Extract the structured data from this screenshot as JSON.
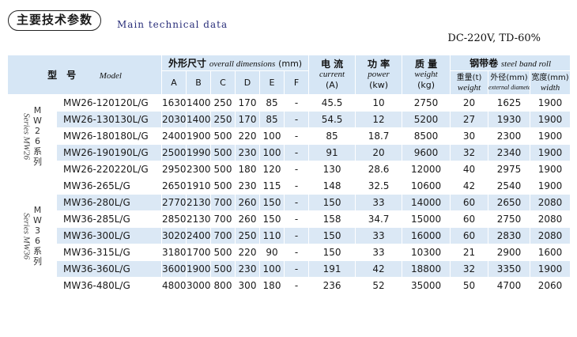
{
  "header": {
    "title": "主要技术参数",
    "subtitle": "Main technical data",
    "conditions": "DC-220V, TD-60%"
  },
  "table": {
    "model_header": {
      "cn": "型　号",
      "en": "Model"
    },
    "dimensions_header": {
      "cn": "外形尺寸",
      "en": "overall dimensions",
      "unit": "(mm)"
    },
    "dimension_cols": [
      "A",
      "B",
      "C",
      "D",
      "E",
      "F"
    ],
    "current_header": {
      "cn": "电 流",
      "en": "current",
      "unit": "(A)"
    },
    "power_header": {
      "cn": "功 率",
      "en": "power",
      "unit": "(kw)"
    },
    "weight_header": {
      "cn": "质 量",
      "en": "weight",
      "unit": "(kg)"
    },
    "band_header": {
      "cn": "钢带卷",
      "en": "steel band roll"
    },
    "band_cols": [
      {
        "cn": "重量(t)",
        "en": "weight"
      },
      {
        "cn": "外径(mm)",
        "en": "external diameter"
      },
      {
        "cn": "宽度(mm)",
        "en": "width"
      }
    ],
    "groups": [
      {
        "series_en": "Series MW26",
        "series_cn": "MW26系列",
        "rows": [
          {
            "model": "MW26-120120L/G",
            "A": "1630",
            "B": "1400",
            "C": "250",
            "D": "170",
            "E": "85",
            "F": "-",
            "current": "45.5",
            "power": "10",
            "weight": "2750",
            "band_weight": "20",
            "band_od": "1625",
            "band_width": "1900"
          },
          {
            "model": "MW26-130130L/G",
            "A": "2030",
            "B": "1400",
            "C": "250",
            "D": "170",
            "E": "85",
            "F": "-",
            "current": "54.5",
            "power": "12",
            "weight": "5200",
            "band_weight": "27",
            "band_od": "1930",
            "band_width": "1900"
          },
          {
            "model": "MW26-180180L/G",
            "A": "2400",
            "B": "1900",
            "C": "500",
            "D": "220",
            "E": "100",
            "F": "-",
            "current": "85",
            "power": "18.7",
            "weight": "8500",
            "band_weight": "30",
            "band_od": "2300",
            "band_width": "1900"
          },
          {
            "model": "MW26-190190L/G",
            "A": "2500",
            "B": "1990",
            "C": "500",
            "D": "230",
            "E": "100",
            "F": "-",
            "current": "91",
            "power": "20",
            "weight": "9600",
            "band_weight": "32",
            "band_od": "2340",
            "band_width": "1900"
          },
          {
            "model": "MW26-220220L/G",
            "A": "2950",
            "B": "2300",
            "C": "500",
            "D": "180",
            "E": "120",
            "F": "-",
            "current": "130",
            "power": "28.6",
            "weight": "12000",
            "band_weight": "40",
            "band_od": "2975",
            "band_width": "1900"
          }
        ]
      },
      {
        "series_en": "Series MW36",
        "series_cn": "MW36系列",
        "rows": [
          {
            "model": "MW36-265L/G",
            "A": "2650",
            "B": "1910",
            "C": "500",
            "D": "230",
            "E": "115",
            "F": "-",
            "current": "148",
            "power": "32.5",
            "weight": "10600",
            "band_weight": "42",
            "band_od": "2540",
            "band_width": "1900"
          },
          {
            "model": "MW36-280L/G",
            "A": "2770",
            "B": "2130",
            "C": "700",
            "D": "260",
            "E": "150",
            "F": "-",
            "current": "150",
            "power": "33",
            "weight": "14000",
            "band_weight": "60",
            "band_od": "2650",
            "band_width": "2080"
          },
          {
            "model": "MW36-285L/G",
            "A": "2850",
            "B": "2130",
            "C": "700",
            "D": "260",
            "E": "150",
            "F": "-",
            "current": "158",
            "power": "34.7",
            "weight": "15000",
            "band_weight": "60",
            "band_od": "2750",
            "band_width": "2080"
          },
          {
            "model": "MW36-300L/G",
            "A": "3020",
            "B": "2400",
            "C": "700",
            "D": "250",
            "E": "110",
            "F": "-",
            "current": "150",
            "power": "33",
            "weight": "16000",
            "band_weight": "60",
            "band_od": "2830",
            "band_width": "2080"
          },
          {
            "model": "MW36-315L/G",
            "A": "3180",
            "B": "1700",
            "C": "500",
            "D": "220",
            "E": "90",
            "F": "-",
            "current": "150",
            "power": "33",
            "weight": "10300",
            "band_weight": "21",
            "band_od": "2900",
            "band_width": "1600"
          },
          {
            "model": "MW36-360L/G",
            "A": "3600",
            "B": "1900",
            "C": "500",
            "D": "230",
            "E": "100",
            "F": "-",
            "current": "191",
            "power": "42",
            "weight": "18800",
            "band_weight": "32",
            "band_od": "3350",
            "band_width": "1900"
          },
          {
            "model": "MW36-480L/G",
            "A": "4800",
            "B": "3000",
            "C": "800",
            "D": "300",
            "E": "180",
            "F": "-",
            "current": "236",
            "power": "52",
            "weight": "35000",
            "band_weight": "50",
            "band_od": "4700",
            "band_width": "2060"
          }
        ]
      }
    ]
  }
}
